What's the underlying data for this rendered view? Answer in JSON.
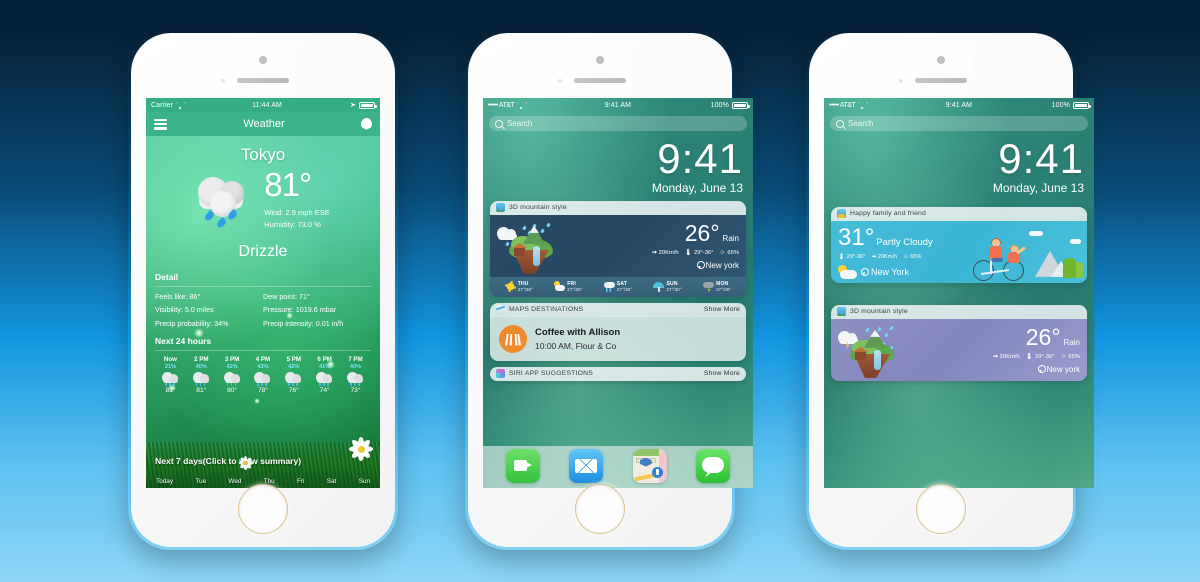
{
  "background": {
    "top_color": "#06223a",
    "mid_color": "#1295e0",
    "bottom_color": "#8ed5f5"
  },
  "phone1": {
    "status": {
      "carrier": "Carrier",
      "time": "11:44 AM",
      "wifi_icon": "wifi-icon",
      "location_icon": "location-arrow-icon",
      "battery_icon": "battery-icon"
    },
    "nav": {
      "menu_icon": "hamburger-menu-icon",
      "title": "Weather",
      "location_icon": "location-pin-icon"
    },
    "current": {
      "city": "Tokyo",
      "temp": "81°",
      "wind": "Wind: 2.9 mph ESE",
      "humidity": "Humidity: 73.0 %",
      "condition": "Drizzle",
      "weather_icon": "rain-cloud-icon"
    },
    "detail": {
      "title": "Detail",
      "items": [
        {
          "label": "Feels like: 86°"
        },
        {
          "label": "Dew point: 71°"
        },
        {
          "label": "Visibility: 5.0 miles"
        },
        {
          "label": "Pressure: 1019.6 mbar"
        },
        {
          "label": "Precip probability: 34%"
        },
        {
          "label": "Precip intensity: 0.01 in/h"
        }
      ]
    },
    "hourly": {
      "title": "Next 24 hours",
      "entries": [
        {
          "time": "Now",
          "precip": "21%",
          "temp": "81°"
        },
        {
          "time": "2 PM",
          "precip": "40%",
          "temp": "81°"
        },
        {
          "time": "3 PM",
          "precip": "42%",
          "temp": "80°"
        },
        {
          "time": "4 PM",
          "precip": "43%",
          "temp": "78°"
        },
        {
          "time": "5 PM",
          "precip": "42%",
          "temp": "76°"
        },
        {
          "time": "6 PM",
          "precip": "41%",
          "temp": "74°"
        },
        {
          "time": "7 PM",
          "precip": "40%",
          "temp": "73°"
        }
      ]
    },
    "weekly": {
      "banner": "Next 7 days(Click to view summary)",
      "days": [
        "Today",
        "Tue",
        "Wed",
        "Thu",
        "Fri",
        "Sat",
        "Sun"
      ]
    }
  },
  "phone2": {
    "status": {
      "carrier": "••••• AT&T",
      "time": "9:41 AM",
      "battery": "100%",
      "wifi_icon": "wifi-icon",
      "battery_icon": "battery-icon"
    },
    "search": {
      "placeholder": "Search",
      "icon": "search-icon"
    },
    "clock": {
      "time": "9:41",
      "date": "Monday, June 13"
    },
    "widget_weather": {
      "header_title": "3D mountain style",
      "app_icon": "mountain-app-icon",
      "temp": "26°",
      "condition": "Rain",
      "wind": "20Km/h",
      "range": "29°-36°",
      "humidity": "65%",
      "location": "New york",
      "wind_icon": "wind-icon",
      "temp_icon": "thermometer-icon",
      "humidity_icon": "humidity-icon",
      "location_icon": "location-pin-icon",
      "forecast": [
        {
          "day": "THU",
          "range": "27°/30°",
          "icon": "sun-icon"
        },
        {
          "day": "FRI",
          "range": "27°/30°",
          "icon": "partly-cloudy-icon"
        },
        {
          "day": "SAT",
          "range": "27°/30°",
          "icon": "rain-cloud-icon"
        },
        {
          "day": "SUN",
          "range": "27°/30°",
          "icon": "umbrella-icon"
        },
        {
          "day": "MON",
          "range": "27°/30°",
          "icon": "thunderstorm-icon"
        }
      ]
    },
    "widget_maps": {
      "header_title": "MAPS DESTINATIONS",
      "show_more": "Show More",
      "app_icon": "maps-app-icon",
      "avatar_icon": "coffee-cup-icon",
      "event_title": "Coffee with Allison",
      "event_detail": "10:00 AM, Flour & Co"
    },
    "widget_siri": {
      "header_title": "SIRI APP SUGGESTIONS",
      "show_more": "Show More",
      "app_icon": "siri-app-icon",
      "apps": [
        {
          "name": "facetime-app-icon"
        },
        {
          "name": "mail-app-icon"
        },
        {
          "name": "maps-app-icon"
        },
        {
          "name": "messages-app-icon"
        }
      ]
    }
  },
  "phone3": {
    "status": {
      "carrier": "••••• AT&T",
      "time": "9:41 AM",
      "battery": "100%"
    },
    "search": {
      "placeholder": "Search",
      "icon": "search-icon"
    },
    "clock": {
      "time": "9:41",
      "date": "Monday, June 13"
    },
    "widget_family": {
      "header_title": "Happy family and friend",
      "app_icon": "family-app-icon",
      "temp": "31°",
      "condition": "Partly Cloudy",
      "range": "29°-36°",
      "wind": "20Km/h",
      "humidity": "65%",
      "location": "New York",
      "weather_icon": "partly-cloudy-icon",
      "location_icon": "location-pin-icon",
      "illustration": "family-cycling-illustration"
    },
    "widget_mountain": {
      "header_title": "3D mountain style",
      "app_icon": "mountain-app-icon",
      "temp": "26°",
      "condition": "Rain",
      "wind": "20Km/h",
      "range": "29°-36°",
      "humidity": "65%",
      "location": "New york",
      "illustration": "floating-island-illustration"
    }
  }
}
